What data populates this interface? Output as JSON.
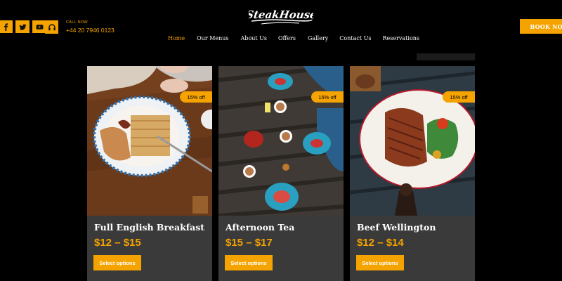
{
  "header": {
    "social_icons": [
      "facebook-icon",
      "twitter-icon",
      "youtube-icon"
    ],
    "call_icon": "headphones-icon",
    "call_label": "CALL NOW",
    "call_number": "+44 20 7946 0123",
    "logo_text": "SteakHouse",
    "book_label": "BOOK NOW",
    "book_icon": "bookmark-icon"
  },
  "nav": {
    "items": [
      "Home",
      "Our Menus",
      "About Us",
      "Offers",
      "Gallery",
      "Contact Us",
      "Reservations"
    ],
    "active": "Home"
  },
  "products": [
    {
      "name": "Full English Breakfast",
      "price": "$12 – $15",
      "badge": "15% off",
      "button": "Select options"
    },
    {
      "name": "Afternoon Tea",
      "price": "$15 – $17",
      "badge": "15% off",
      "button": "Select options"
    },
    {
      "name": "Beef Wellington",
      "price": "$12 – $14",
      "badge": "15% off",
      "button": "Select options"
    }
  ],
  "colors": {
    "accent": "#f5a300",
    "background": "#000000",
    "card": "#3a3a3a"
  }
}
